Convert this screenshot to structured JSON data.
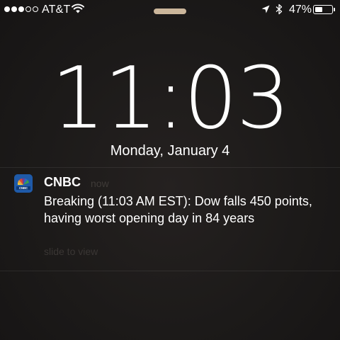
{
  "status_bar": {
    "signal_bars": 3,
    "signal_total": 5,
    "carrier": "AT&T",
    "wifi_icon": "wifi-icon",
    "location_icon": "location-arrow-icon",
    "bluetooth_icon": "bluetooth-icon",
    "battery_percent": "47%",
    "battery_level": 0.47
  },
  "lock_screen": {
    "time": "11:03",
    "date": "Monday, January 4"
  },
  "notification": {
    "app_icon": "cnbc-peacock-icon",
    "app_name": "CNBC",
    "time": "now",
    "message": "Breaking (11:03 AM EST): Dow falls 450 points, having worst opening day in 84 years",
    "action_hint": "slide to view"
  },
  "colors": {
    "background": "#1c1a19",
    "text": "#ffffff",
    "muted_text": "#3f3b38",
    "handle": "#cbb69b",
    "cnbc_blue": "#1f5aa8"
  }
}
